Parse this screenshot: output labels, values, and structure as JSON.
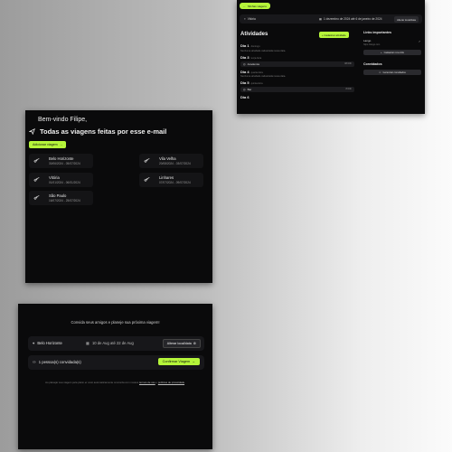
{
  "trip": {
    "back_label": "Minhas viagens",
    "location": "Vitória",
    "dates": "1 dezembro de 2024 até 6 de janeiro de 2024",
    "change_label": "Alterar local/data",
    "activities_title": "Atividades",
    "register_label": "Cadastrar atividade",
    "days": [
      {
        "label": "Dia 1",
        "weekday": "domingo",
        "empty_text": "Nenhuma atividade cadastrada nessa data.",
        "items": []
      },
      {
        "label": "Dia 3",
        "weekday": "terça-feira",
        "empty_text": "",
        "items": [
          {
            "name": "Academia",
            "time": "08:00h"
          }
        ]
      },
      {
        "label": "Dia 4",
        "weekday": "quarta-feira",
        "empty_text": "Nenhuma atividade cadastrada nessa data.",
        "items": []
      },
      {
        "label": "Dia 5",
        "weekday": "quinta-feira",
        "empty_text": "",
        "items": [
          {
            "name": "Bar",
            "time": "8:00h"
          }
        ]
      },
      {
        "label": "Dia 6",
        "weekday": "",
        "empty_text": "",
        "items": []
      }
    ],
    "links_title": "Links importantes",
    "link": {
      "title": "Lango",
      "url": "https://lango.com"
    },
    "register_link_label": "Cadastrar novo link",
    "guests_title": "Convidados",
    "manage_guests_label": "Gerenciar convidados"
  },
  "welcome": {
    "greeting": "Bem-vindo Filipe,",
    "heading": "Todas as viagens feitas por esse e-mail",
    "add_trip_label": "Adicionar viagem",
    "trips": [
      {
        "name": "Belo Horizonte",
        "dates": "30/06/2024 - 05/07/2024"
      },
      {
        "name": "Vitória",
        "dates": "01/01/2024 - 06/01/2024"
      },
      {
        "name": "São Paulo",
        "dates": "16/07/2024 - 25/07/2024"
      },
      {
        "name": "Vila Velha",
        "dates": "20/08/2024 - 03/07/2024"
      },
      {
        "name": "Linhares",
        "dates": "07/07/2024 - 09/07/2024"
      }
    ]
  },
  "invite": {
    "tagline": "Convida seus amigos e planeje sua próxima viagem!",
    "location": "Belo Horizonte",
    "dates": "10 de Aug até 22 de Aug",
    "change_label": "Alterar local/data",
    "guests": "1 pessoa(s) convidada(s)",
    "confirm_label": "Confirmar Viagem",
    "footer_prefix": "Ao planejar sua viagem pela plann.er você automaticamente concorda com nossos",
    "terms_label": "termos de uso",
    "footer_mid": "e",
    "privacy_label": "políticas de privacidade",
    "footer_end": "."
  },
  "colors": {
    "accent": "#b5f53a",
    "panel": "#0a0a0b",
    "card": "#141416"
  }
}
